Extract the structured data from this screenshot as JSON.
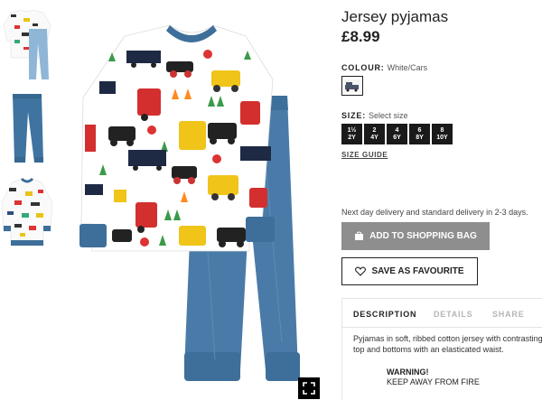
{
  "product": {
    "title": "Jersey pyjamas",
    "price": "£8.99"
  },
  "colour": {
    "label": "COLOUR:",
    "value": "White/Cars"
  },
  "size": {
    "label": "SIZE:",
    "placeholder": "Select size",
    "options": [
      {
        "top": "1½",
        "bottom": "2Y"
      },
      {
        "top": "2",
        "bottom": "4Y"
      },
      {
        "top": "4",
        "bottom": "6Y"
      },
      {
        "top": "6",
        "bottom": "8Y"
      },
      {
        "top": "8",
        "bottom": "10Y"
      }
    ],
    "guide_label": "SIZE GUIDE"
  },
  "delivery_text": "Next day delivery and standard delivery in 2-3 days.",
  "actions": {
    "add_to_bag": "ADD TO SHOPPING BAG",
    "save_favourite": "SAVE AS FAVOURITE"
  },
  "tabs": {
    "description": "DESCRIPTION",
    "details": "DETAILS",
    "share": "SHARE"
  },
  "description": {
    "line1": "Pyjamas in soft, ribbed cotton jersey with contrasting",
    "line2": "top and bottoms with an elasticated waist.",
    "warning_title": "WARNING!",
    "warning_text": "KEEP AWAY FROM FIRE"
  },
  "icons": {
    "zoom": "expand-icon",
    "bag": "shopping-bag-icon",
    "heart": "heart-icon"
  },
  "colors": {
    "button_grey": "#8e8e8e",
    "size_button": "#1a1a1a",
    "pyjama_blue": "#4a7ba8",
    "cuff_blue": "#3d6f9a"
  }
}
